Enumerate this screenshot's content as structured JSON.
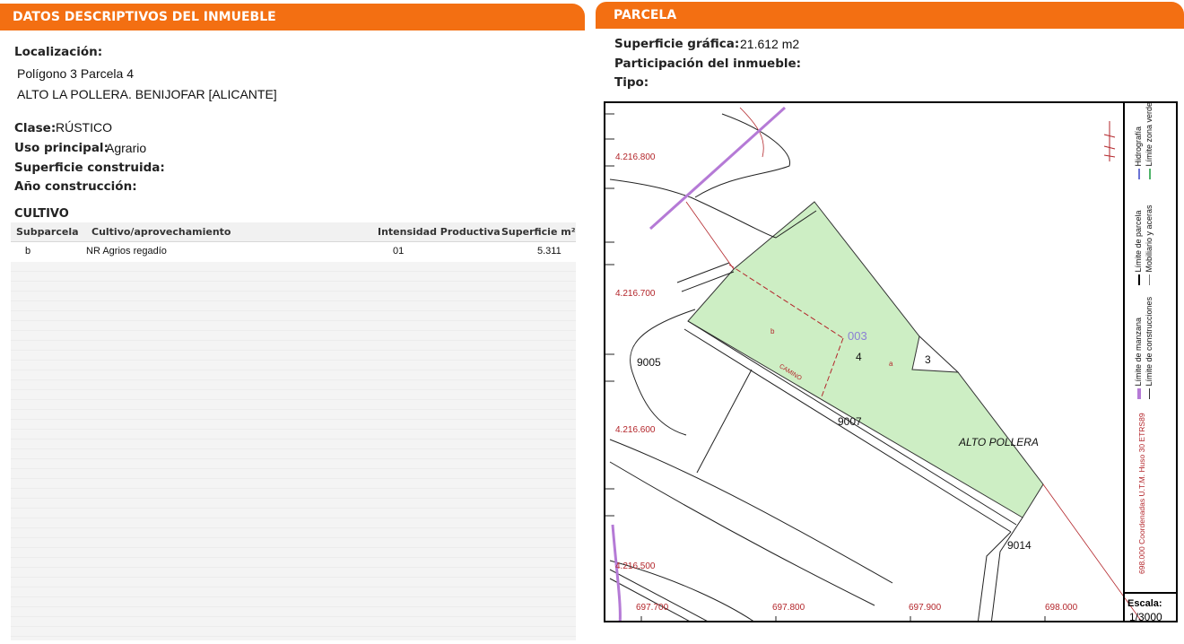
{
  "left": {
    "header": "DATOS DESCRIPTIVOS DEL INMUEBLE",
    "localizacion_label": "Localización:",
    "localizacion_line1": "Polígono 3 Parcela 4",
    "localizacion_line2": "ALTO LA POLLERA. BENIJOFAR [ALICANTE]",
    "clase_label": "Clase:",
    "clase_value": "RÚSTICO",
    "uso_label": "Uso principal:",
    "uso_value": "Agrario",
    "superficie_construida_label": "Superficie construida:",
    "anio_label": "Año construcción:",
    "cultivo": {
      "title": "CULTIVO",
      "columns": [
        "Subparcela",
        "Cultivo/aprovechamiento",
        "Intensidad Productiva",
        "Superficie m²"
      ],
      "rows": [
        {
          "subparcela": "b",
          "cultivo": "NR Agrios regadío",
          "intensidad": "01",
          "superficie": "5.311"
        }
      ]
    }
  },
  "right": {
    "header": "PARCELA",
    "superficie_grafica_label": "Superficie gráfica:",
    "superficie_grafica_value": "21.612 m2",
    "participacion_label": "Participación del inmueble:",
    "tipo_label": "Tipo:",
    "map": {
      "y_coords": [
        "4.216.800",
        "4.216.700",
        "4.216.600",
        "4.216.500"
      ],
      "x_coords": [
        "697.700",
        "697.800",
        "697.900",
        "698.000"
      ],
      "labels": {
        "sheet": "003",
        "parcel": "4",
        "neighbor": "3",
        "sub_b": "b",
        "sub_a": "a",
        "road1": "9005",
        "road2": "9007",
        "road3": "9014",
        "place": "ALTO POLLERA",
        "camino": "CAMINO"
      },
      "legend": {
        "manzana": "Límite de manzana",
        "construcciones": "Límite de construcciones",
        "parcela": "Límite de parcela",
        "mobiliario": "Mobiliario y aceras",
        "hidrografia": "Hidrografía",
        "zona_verde": "Límite zona verde",
        "coords": "698.000 Coordenadas U.T.M. Huso 30 ETRS89"
      },
      "scale_label": "Escala:",
      "scale_value": "1/3000",
      "colors": {
        "parcel_fill": "#cdeec4",
        "coord_text": "#b3262b",
        "manzana": "#b57ad6",
        "accent": "#f36f12"
      }
    }
  }
}
